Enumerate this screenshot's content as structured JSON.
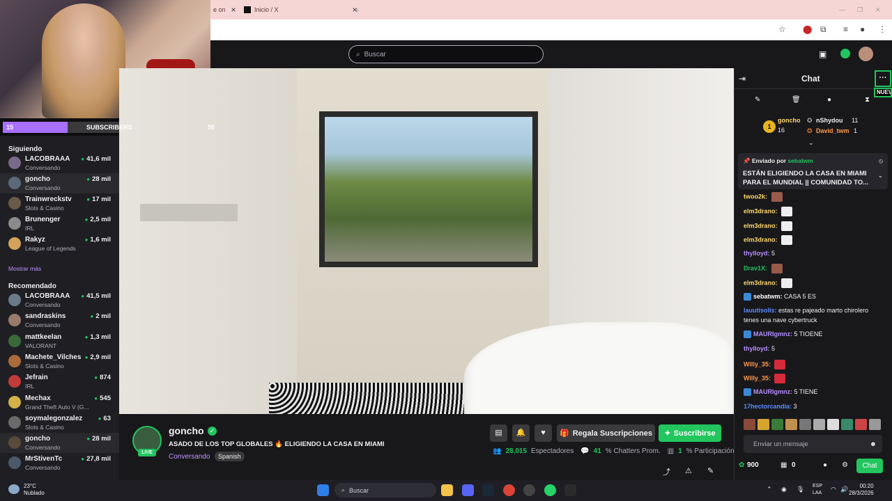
{
  "browser": {
    "tabs": [
      {
        "title": "e on"
      },
      {
        "title": "Inicio / X"
      }
    ]
  },
  "subscriber_goal": {
    "current": "15",
    "label": "SUBSCRIBERS",
    "target": "50",
    "progress": 0.3
  },
  "search": {
    "placeholder": "Buscar"
  },
  "sidebar": {
    "following_header": "Siguiendo",
    "following": [
      {
        "name": "LACOBRAAA",
        "game": "Conversando",
        "viewers": "41,6 mil"
      },
      {
        "name": "goncho",
        "game": "Conversando",
        "viewers": "28 mil"
      },
      {
        "name": "Trainwreckstv",
        "game": "Slots & Casino",
        "viewers": "17 mil"
      },
      {
        "name": "Brunenger",
        "game": "IRL",
        "viewers": "2,5 mil"
      },
      {
        "name": "Rakyz",
        "game": "League of Legends",
        "viewers": "1,6 mil"
      }
    ],
    "show_more": "Mostrar más",
    "recommended_header": "Recomendado",
    "recommended": [
      {
        "name": "LACOBRAAA",
        "game": "Conversando",
        "viewers": "41,5 mil"
      },
      {
        "name": "sandraskins",
        "game": "Conversando",
        "viewers": "2 mil"
      },
      {
        "name": "mattkeelan",
        "game": "VALORANT",
        "viewers": "1,3 mil"
      },
      {
        "name": "Machete_Vilches",
        "game": "Slots & Casino",
        "viewers": "2,9 mil"
      },
      {
        "name": "Jefrain",
        "game": "IRL",
        "viewers": "874"
      },
      {
        "name": "Mechax",
        "game": "Grand Theft Auto V (G...",
        "viewers": "545"
      },
      {
        "name": "soymalegonzalez",
        "game": "Slots & Casino",
        "viewers": "63"
      },
      {
        "name": "goncho",
        "game": "Conversando",
        "viewers": "28 mil"
      },
      {
        "name": "MrStivenTc",
        "game": "Conversando",
        "viewers": "27,8 mil"
      }
    ]
  },
  "stream": {
    "channel": "goncho",
    "live": "LIVE",
    "title": "ASADO DE LOS TOP GLOBALES 🔥 ELIGIENDO LA CASA EN MIAMI",
    "category": "Conversando",
    "language": "Spanish",
    "gift_label": "Regala Suscripciones",
    "subscribe_label": "Suscribirse",
    "viewers": "28,015",
    "viewers_label": "Espectadores",
    "chatters": "41",
    "chatters_label": "% Chatters Prom.",
    "participation": "1",
    "participation_label": "% Participación"
  },
  "chat": {
    "title": "Chat",
    "new_badge": "NUEV",
    "leaders": [
      {
        "name": "goncho",
        "count": "16"
      },
      {
        "name": "nShydou",
        "count": "11"
      },
      {
        "name": "David_twm",
        "count": "1"
      }
    ],
    "pinned": {
      "sent_by": "Enviado por",
      "user": "sebatwm",
      "message": "ESTÁN ELIGIENDO LA CASA EN MIAMI PARA EL MUNDIAL || COMUNIDAD TO..."
    },
    "messages": [
      {
        "user": "twoo2k:",
        "text": "",
        "color": "#ffd86b"
      },
      {
        "user": "elm3drano:",
        "text": "",
        "color": "#ffd86b"
      },
      {
        "user": "elm3drano:",
        "text": "",
        "color": "#ffd86b"
      },
      {
        "user": "elm3drano:",
        "text": "",
        "color": "#ffd86b"
      },
      {
        "user": "thylloyd:",
        "text": "5",
        "color": "#b48cff"
      },
      {
        "user": "Drav1X:",
        "text": "",
        "color": "#22c55e"
      },
      {
        "user": "elm3drano:",
        "text": "",
        "color": "#ffd86b"
      },
      {
        "user": "sebatwm:",
        "text": "CASA 5 ES",
        "color": "#ffffff"
      },
      {
        "user": "lauutisolis:",
        "text": "estas re pajeado marto chirolero",
        "color": "#5c8cff"
      },
      {
        "user": "",
        "text": "tenes una nave cybertruck",
        "color": "#ffffff"
      },
      {
        "user": "MAURIgmnz:",
        "text": "5 TIOENE",
        "color": "#b48cff"
      },
      {
        "user": "thylloyd:",
        "text": "5",
        "color": "#b48cff"
      },
      {
        "user": "Willy_35:",
        "text": "",
        "color": "#ff9a4a"
      },
      {
        "user": "Willy_35:",
        "text": "",
        "color": "#ff9a4a"
      },
      {
        "user": "MAURIgmnz:",
        "text": "5 TIENE",
        "color": "#b48cff"
      },
      {
        "user": "17hectorcandia:",
        "text": "3",
        "color": "#5c8cff"
      }
    ],
    "input_placeholder": "Enviar un mensaje",
    "points": "900",
    "bits": "0",
    "chat_button": "Chat"
  },
  "taskbar": {
    "weather_temp": "23°C",
    "weather_desc": "Nublado",
    "search_label": "Buscar",
    "lang1": "ESP",
    "lang2": "LAA",
    "time": "00:20",
    "date": "28/3/2026"
  }
}
